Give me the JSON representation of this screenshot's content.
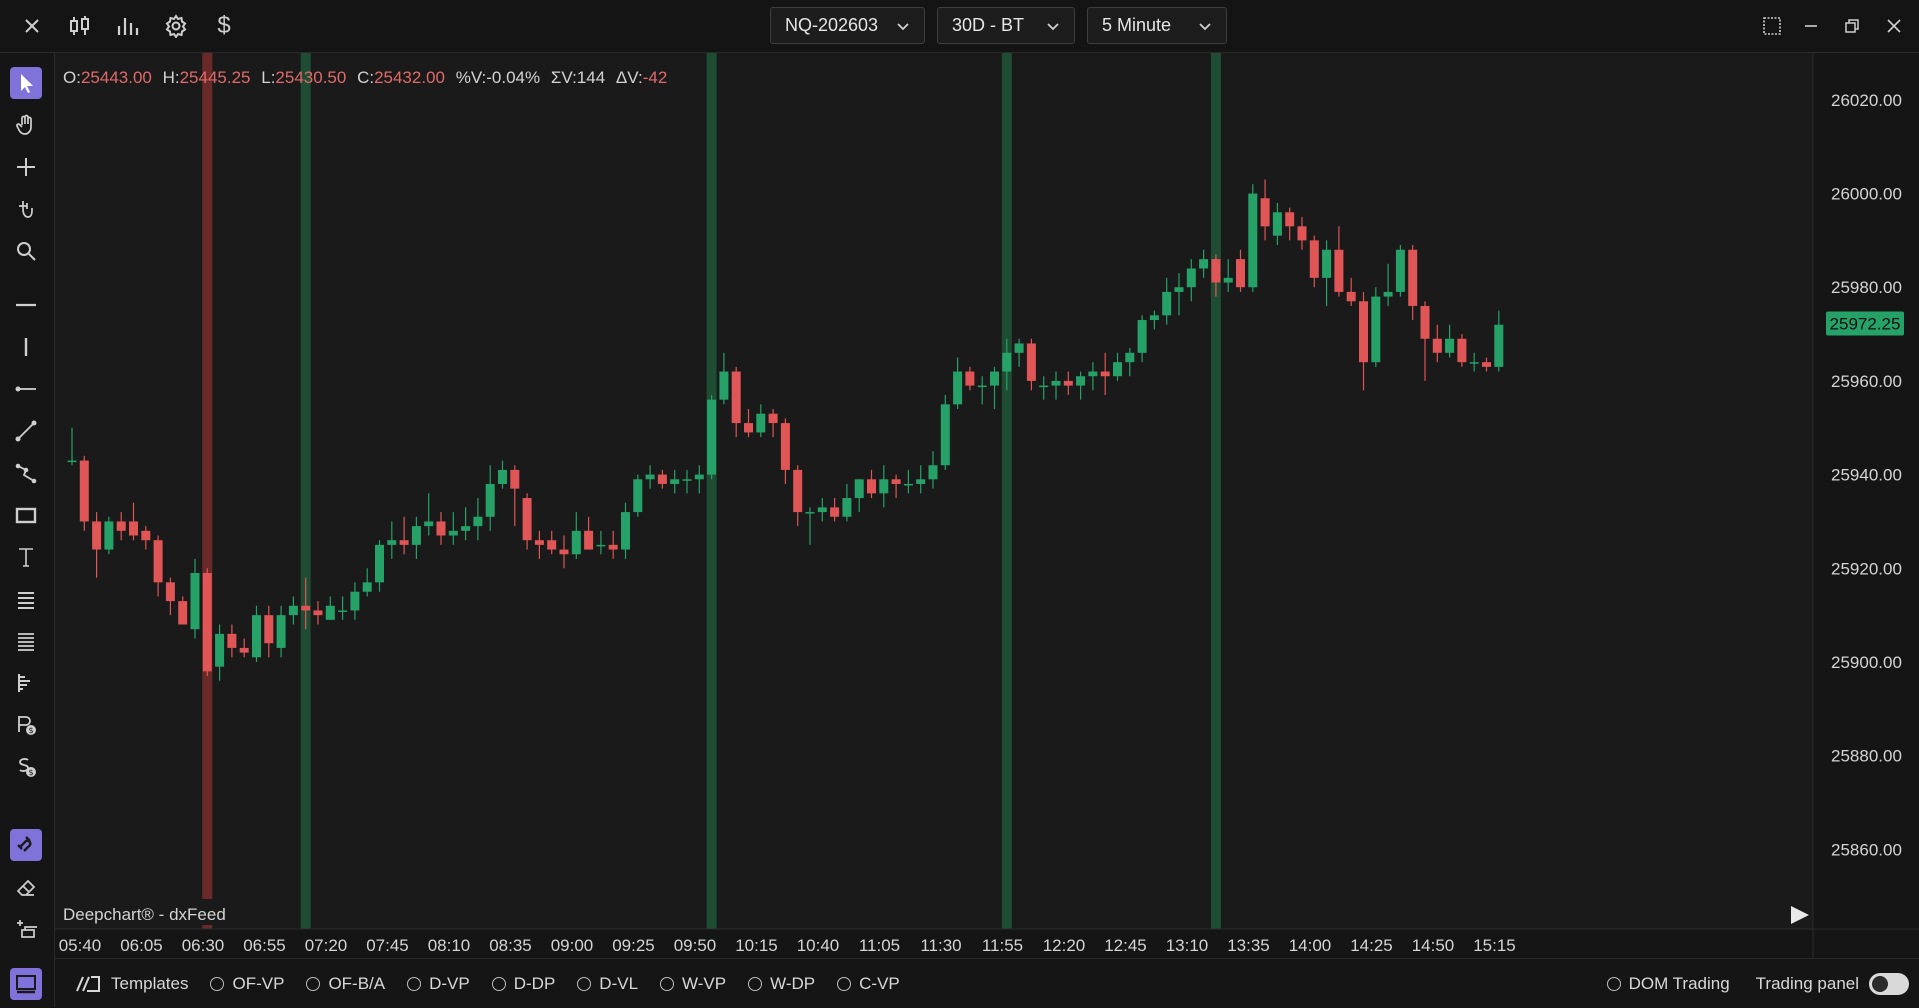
{
  "topbar": {
    "symbol": "NQ-202603",
    "range": "30D - BT",
    "interval": "5 Minute"
  },
  "ohlc": {
    "o_label": "O:",
    "o": "25443.00",
    "h_label": "H:",
    "h": "25445.25",
    "l_label": "L:",
    "l": "25430.50",
    "c_label": "C:",
    "c": "25432.00",
    "pv_label": "%V:",
    "pv": "-0.04%",
    "sv_label": "ΣV:",
    "sv": "144",
    "dv_label": "ΔV:",
    "dv": "-42"
  },
  "watermark": "Deepchart® - dxFeed",
  "current_price": "25972.25",
  "bottombar": {
    "templates": "Templates",
    "toggles": [
      "OF-VP",
      "OF-B/A",
      "D-VP",
      "D-DP",
      "D-VL",
      "W-VP",
      "W-DP",
      "C-VP"
    ],
    "dom_trading": "DOM Trading",
    "trading_panel": "Trading panel"
  },
  "colors": {
    "up": "#26a269",
    "down": "#e05555",
    "highlight_green": "#1f4d34",
    "highlight_red": "#6b2a2a",
    "accent": "#7f73d9"
  },
  "chart_data": {
    "type": "candlestick",
    "y_ticks": [
      26020,
      26000,
      25980,
      25960,
      25940,
      25920,
      25900,
      25880,
      25860
    ],
    "ylim": [
      25843,
      26030
    ],
    "x_tick_labels": [
      "05:40",
      "06:05",
      "06:30",
      "06:55",
      "07:20",
      "07:45",
      "08:10",
      "08:35",
      "09:00",
      "09:25",
      "09:50",
      "10:15",
      "10:40",
      "11:05",
      "11:30",
      "11:55",
      "12:20",
      "12:45",
      "13:10",
      "13:35",
      "14:00",
      "14:25",
      "14:50",
      "15:15"
    ],
    "highlight_bars": [
      {
        "index": 11,
        "color": "red"
      },
      {
        "index": 19,
        "color": "green"
      },
      {
        "index": 52,
        "color": "green"
      },
      {
        "index": 76,
        "color": "green"
      },
      {
        "index": 93,
        "color": "green"
      }
    ],
    "candles": [
      [
        25943,
        25950,
        25942,
        25943
      ],
      [
        25943,
        25944,
        25928,
        25930
      ],
      [
        25930,
        25932,
        25918,
        25924
      ],
      [
        25924,
        25931,
        25923,
        25930
      ],
      [
        25930,
        25932,
        25926,
        25928
      ],
      [
        25930,
        25934,
        25926,
        25927
      ],
      [
        25928,
        25929,
        25924,
        25926
      ],
      [
        25926,
        25927,
        25914,
        25917
      ],
      [
        25917,
        25918,
        25910,
        25913
      ],
      [
        25913,
        25914,
        25908,
        25908
      ],
      [
        25907,
        25922,
        25905,
        25919
      ],
      [
        25919,
        25920,
        25897,
        25898
      ],
      [
        25899,
        25908,
        25896,
        25906
      ],
      [
        25906,
        25908,
        25901,
        25903
      ],
      [
        25903,
        25905,
        25901,
        25902
      ],
      [
        25901,
        25912,
        25900,
        25910
      ],
      [
        25910,
        25912,
        25901,
        25904
      ],
      [
        25903,
        25912,
        25901,
        25910
      ],
      [
        25910,
        25914,
        25908,
        25912
      ],
      [
        25912,
        25918,
        25907,
        25911
      ],
      [
        25911,
        25913,
        25908,
        25910
      ],
      [
        25909,
        25914,
        25909,
        25912
      ],
      [
        25911,
        25914,
        25909,
        25911
      ],
      [
        25911,
        25917,
        25909,
        25915
      ],
      [
        25915,
        25920,
        25914,
        25917
      ],
      [
        25917,
        25926,
        25915,
        25925
      ],
      [
        25925,
        25930,
        25922,
        25926
      ],
      [
        25926,
        25931,
        25923,
        25925
      ],
      [
        25925,
        25931,
        25922,
        25929
      ],
      [
        25929,
        25936,
        25927,
        25930
      ],
      [
        25930,
        25932,
        25925,
        25927
      ],
      [
        25927,
        25932,
        25925,
        25928
      ],
      [
        25928,
        25933,
        25926,
        25929
      ],
      [
        25929,
        25935,
        25926,
        25931
      ],
      [
        25931,
        25942,
        25928,
        25938
      ],
      [
        25938,
        25943,
        25937,
        25941
      ],
      [
        25941,
        25942,
        25929,
        25937
      ],
      [
        25935,
        25936,
        25924,
        25926
      ],
      [
        25926,
        25928,
        25922,
        25925
      ],
      [
        25926,
        25928,
        25923,
        25924
      ],
      [
        25924,
        25927,
        25920,
        25923
      ],
      [
        25923,
        25932,
        25922,
        25928
      ],
      [
        25928,
        25931,
        25924,
        25924
      ],
      [
        25925,
        25928,
        25923,
        25925
      ],
      [
        25925,
        25928,
        25922,
        25924
      ],
      [
        25924,
        25934,
        25922,
        25932
      ],
      [
        25932,
        25940,
        25931,
        25939
      ],
      [
        25939,
        25942,
        25937,
        25940
      ],
      [
        25940,
        25941,
        25937,
        25938
      ],
      [
        25938,
        25941,
        25936,
        25939
      ],
      [
        25939,
        25941,
        25936,
        25939
      ],
      [
        25939,
        25942,
        25936,
        25940
      ],
      [
        25940,
        25957,
        25939,
        25956
      ],
      [
        25956,
        25966,
        25955,
        25962
      ],
      [
        25962,
        25963,
        25948,
        25951
      ],
      [
        25951,
        25954,
        25948,
        25949
      ],
      [
        25949,
        25955,
        25948,
        25953
      ],
      [
        25953,
        25954,
        25948,
        25951
      ],
      [
        25951,
        25952,
        25938,
        25941
      ],
      [
        25941,
        25942,
        25929,
        25932
      ],
      [
        25932,
        25933,
        25925,
        25932
      ],
      [
        25932,
        25935,
        25930,
        25933
      ],
      [
        25933,
        25935,
        25930,
        25931
      ],
      [
        25931,
        25938,
        25930,
        25935
      ],
      [
        25935,
        25939,
        25932,
        25939
      ],
      [
        25939,
        25941,
        25935,
        25936
      ],
      [
        25936,
        25942,
        25933,
        25939
      ],
      [
        25939,
        25940,
        25935,
        25938
      ],
      [
        25938,
        25941,
        25936,
        25938
      ],
      [
        25938,
        25942,
        25936,
        25939
      ],
      [
        25939,
        25945,
        25937,
        25942
      ],
      [
        25942,
        25957,
        25941,
        25955
      ],
      [
        25955,
        25965,
        25954,
        25962
      ],
      [
        25962,
        25963,
        25958,
        25959
      ],
      [
        25959,
        25961,
        25955,
        25959
      ],
      [
        25959,
        25963,
        25954,
        25962
      ],
      [
        25962,
        25969,
        25958,
        25966
      ],
      [
        25966,
        25969,
        25963,
        25968
      ],
      [
        25968,
        25969,
        25958,
        25960
      ],
      [
        25959,
        25961,
        25956,
        25959
      ],
      [
        25959,
        25962,
        25956,
        25960
      ],
      [
        25960,
        25962,
        25957,
        25959
      ],
      [
        25959,
        25962,
        25956,
        25961
      ],
      [
        25961,
        25964,
        25958,
        25962
      ],
      [
        25962,
        25966,
        25957,
        25961
      ],
      [
        25961,
        25966,
        25960,
        25964
      ],
      [
        25964,
        25967,
        25961,
        25966
      ],
      [
        25966,
        25974,
        25964,
        25973
      ],
      [
        25973,
        25975,
        25971,
        25974
      ],
      [
        25974,
        25982,
        25972,
        25979
      ],
      [
        25979,
        25983,
        25974,
        25980
      ],
      [
        25980,
        25986,
        25977,
        25984
      ],
      [
        25984,
        25988,
        25982,
        25986
      ],
      [
        25986,
        25987,
        25978,
        25981
      ],
      [
        25981,
        25986,
        25979,
        25982
      ],
      [
        25986,
        25988,
        25979,
        25980
      ],
      [
        25980,
        26002,
        25979,
        26000
      ],
      [
        25999,
        26003,
        25990,
        25993
      ],
      [
        25991,
        25998,
        25989,
        25996
      ],
      [
        25996,
        25997,
        25990,
        25993
      ],
      [
        25993,
        25995,
        25988,
        25990
      ],
      [
        25990,
        25991,
        25980,
        25982
      ],
      [
        25982,
        25990,
        25976,
        25988
      ],
      [
        25988,
        25993,
        25978,
        25979
      ],
      [
        25979,
        25982,
        25976,
        25977
      ],
      [
        25977,
        25979,
        25958,
        25964
      ],
      [
        25964,
        25980,
        25963,
        25978
      ],
      [
        25978,
        25985,
        25976,
        25979
      ],
      [
        25979,
        25989,
        25978,
        25988
      ],
      [
        25988,
        25989,
        25973,
        25976
      ],
      [
        25976,
        25977,
        25960,
        25969
      ],
      [
        25969,
        25972,
        25964,
        25966
      ],
      [
        25966,
        25972,
        25965,
        25969
      ],
      [
        25969,
        25970,
        25963,
        25964
      ],
      [
        25964,
        25966,
        25962,
        25964
      ],
      [
        25964,
        25965,
        25962,
        25963
      ],
      [
        25963,
        25975,
        25962,
        25972
      ]
    ]
  }
}
